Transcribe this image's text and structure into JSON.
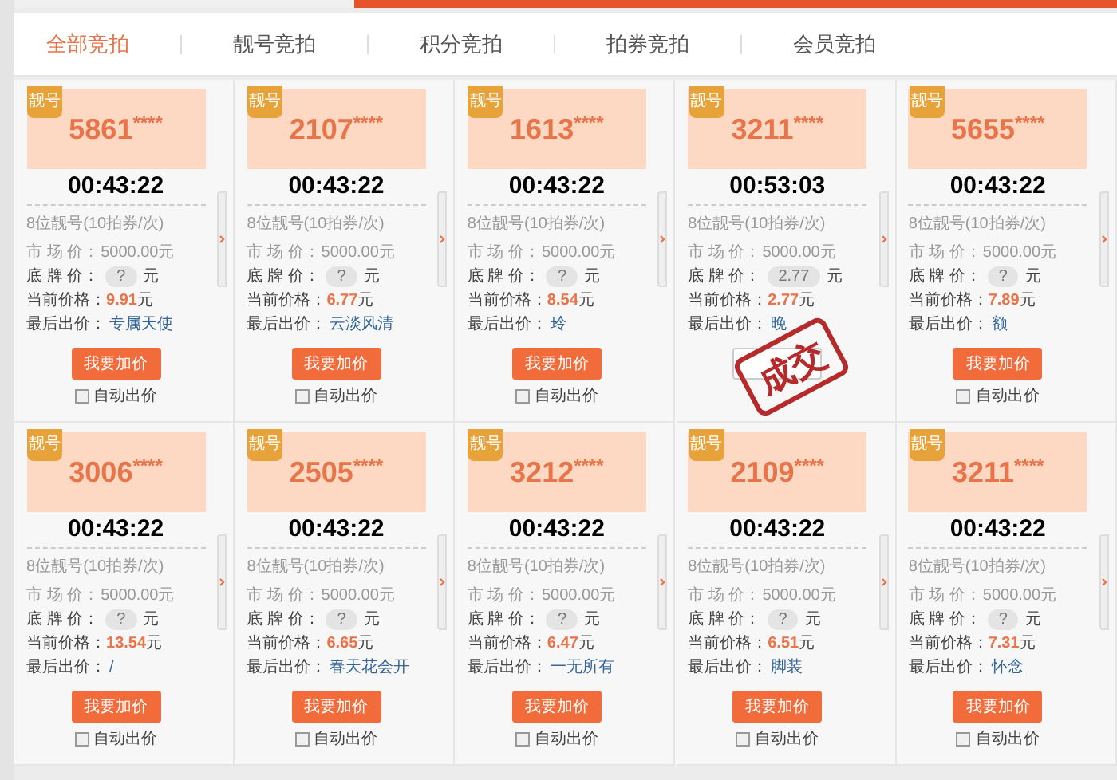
{
  "tabs": [
    {
      "label": "全部竞拍",
      "selected": true
    },
    {
      "label": "靓号竞拍",
      "selected": false
    },
    {
      "label": "积分竞拍",
      "selected": false
    },
    {
      "label": "拍券竞拍",
      "selected": false
    },
    {
      "label": "会员竞拍",
      "selected": false
    }
  ],
  "cards": [
    {
      "badge": "靓号",
      "number": "5861",
      "mask": "****",
      "timer": "00:43:22",
      "desc": "8位靓号(10拍券/次)",
      "market_label": "市 场 价：",
      "market": "5000.00元",
      "floor_label": "底 牌 价：",
      "floor": "?",
      "floor_unit": "元",
      "current_label": "当前价格：",
      "current": "9.91",
      "current_unit": "元",
      "last_label": "最后出价：",
      "last": "专属天使",
      "sold": false,
      "button": "我要加价",
      "auto_label": "自动出价",
      "auto_checked": false
    },
    {
      "badge": "靓号",
      "number": "2107",
      "mask": "****",
      "timer": "00:43:22",
      "desc": "8位靓号(10拍券/次)",
      "market_label": "市 场 价：",
      "market": "5000.00元",
      "floor_label": "底 牌 价：",
      "floor": "?",
      "floor_unit": "元",
      "current_label": "当前价格：",
      "current": "6.77",
      "current_unit": "元",
      "last_label": "最后出价：",
      "last": "云淡风清",
      "sold": false,
      "button": "我要加价",
      "auto_label": "自动出价",
      "auto_checked": false
    },
    {
      "badge": "靓号",
      "number": "1613",
      "mask": "****",
      "timer": "00:43:22",
      "desc": "8位靓号(10拍券/次)",
      "market_label": "市 场 价：",
      "market": "5000.00元",
      "floor_label": "底 牌 价：",
      "floor": "?",
      "floor_unit": "元",
      "current_label": "当前价格：",
      "current": "8.54",
      "current_unit": "元",
      "last_label": "最后出价：",
      "last": "玲",
      "sold": false,
      "button": "我要加价",
      "auto_label": "自动出价",
      "auto_checked": false
    },
    {
      "badge": "靓号",
      "number": "3211",
      "mask": "****",
      "timer": "00:53:03",
      "desc": "8位靓号(10拍券/次)",
      "market_label": "市 场 价：",
      "market": "5000.00元",
      "floor_label": "底 牌 价：",
      "floor": "2.77",
      "floor_unit": "元",
      "current_label": "当前价格：",
      "current": "2.77",
      "current_unit": "元",
      "last_label": "最后出价：",
      "last": "晚",
      "sold": true,
      "stamp": "成交"
    },
    {
      "badge": "靓号",
      "number": "5655",
      "mask": "****",
      "timer": "00:43:22",
      "desc": "8位靓号(10拍券/次)",
      "market_label": "市 场 价：",
      "market": "5000.00元",
      "floor_label": "底 牌 价：",
      "floor": "?",
      "floor_unit": "元",
      "current_label": "当前价格：",
      "current": "7.89",
      "current_unit": "元",
      "last_label": "最后出价：",
      "last": "额",
      "sold": false,
      "button": "我要加价",
      "auto_label": "自动出价",
      "auto_checked": false
    },
    {
      "badge": "靓号",
      "number": "3006",
      "mask": "****",
      "timer": "00:43:22",
      "desc": "8位靓号(10拍券/次)",
      "market_label": "市 场 价：",
      "market": "5000.00元",
      "floor_label": "底 牌 价：",
      "floor": "?",
      "floor_unit": "元",
      "current_label": "当前价格：",
      "current": "13.54",
      "current_unit": "元",
      "last_label": "最后出价：",
      "last": "/",
      "sold": false,
      "button": "我要加价",
      "auto_label": "自动出价",
      "auto_checked": false
    },
    {
      "badge": "靓号",
      "number": "2505",
      "mask": "****",
      "timer": "00:43:22",
      "desc": "8位靓号(10拍券/次)",
      "market_label": "市 场 价：",
      "market": "5000.00元",
      "floor_label": "底 牌 价：",
      "floor": "?",
      "floor_unit": "元",
      "current_label": "当前价格：",
      "current": "6.65",
      "current_unit": "元",
      "last_label": "最后出价：",
      "last": "春天花会开",
      "sold": false,
      "button": "我要加价",
      "auto_label": "自动出价",
      "auto_checked": false
    },
    {
      "badge": "靓号",
      "number": "3212",
      "mask": "****",
      "timer": "00:43:22",
      "desc": "8位靓号(10拍券/次)",
      "market_label": "市 场 价：",
      "market": "5000.00元",
      "floor_label": "底 牌 价：",
      "floor": "?",
      "floor_unit": "元",
      "current_label": "当前价格：",
      "current": "6.47",
      "current_unit": "元",
      "last_label": "最后出价：",
      "last": "一无所有",
      "sold": false,
      "button": "我要加价",
      "auto_label": "自动出价",
      "auto_checked": false
    },
    {
      "badge": "靓号",
      "number": "2109",
      "mask": "****",
      "timer": "00:43:22",
      "desc": "8位靓号(10拍券/次)",
      "market_label": "市 场 价：",
      "market": "5000.00元",
      "floor_label": "底 牌 价：",
      "floor": "?",
      "floor_unit": "元",
      "current_label": "当前价格：",
      "current": "6.51",
      "current_unit": "元",
      "last_label": "最后出价：",
      "last": "脚装",
      "sold": false,
      "button": "我要加价",
      "auto_label": "自动出价",
      "auto_checked": false
    },
    {
      "badge": "靓号",
      "number": "3211",
      "mask": "****",
      "timer": "00:43:22",
      "desc": "8位靓号(10拍券/次)",
      "market_label": "市 场 价：",
      "market": "5000.00元",
      "floor_label": "底 牌 价：",
      "floor": "?",
      "floor_unit": "元",
      "current_label": "当前价格：",
      "current": "7.31",
      "current_unit": "元",
      "last_label": "最后出价：",
      "last": "怀念",
      "sold": false,
      "button": "我要加价",
      "auto_label": "自动出价",
      "auto_checked": false
    }
  ]
}
